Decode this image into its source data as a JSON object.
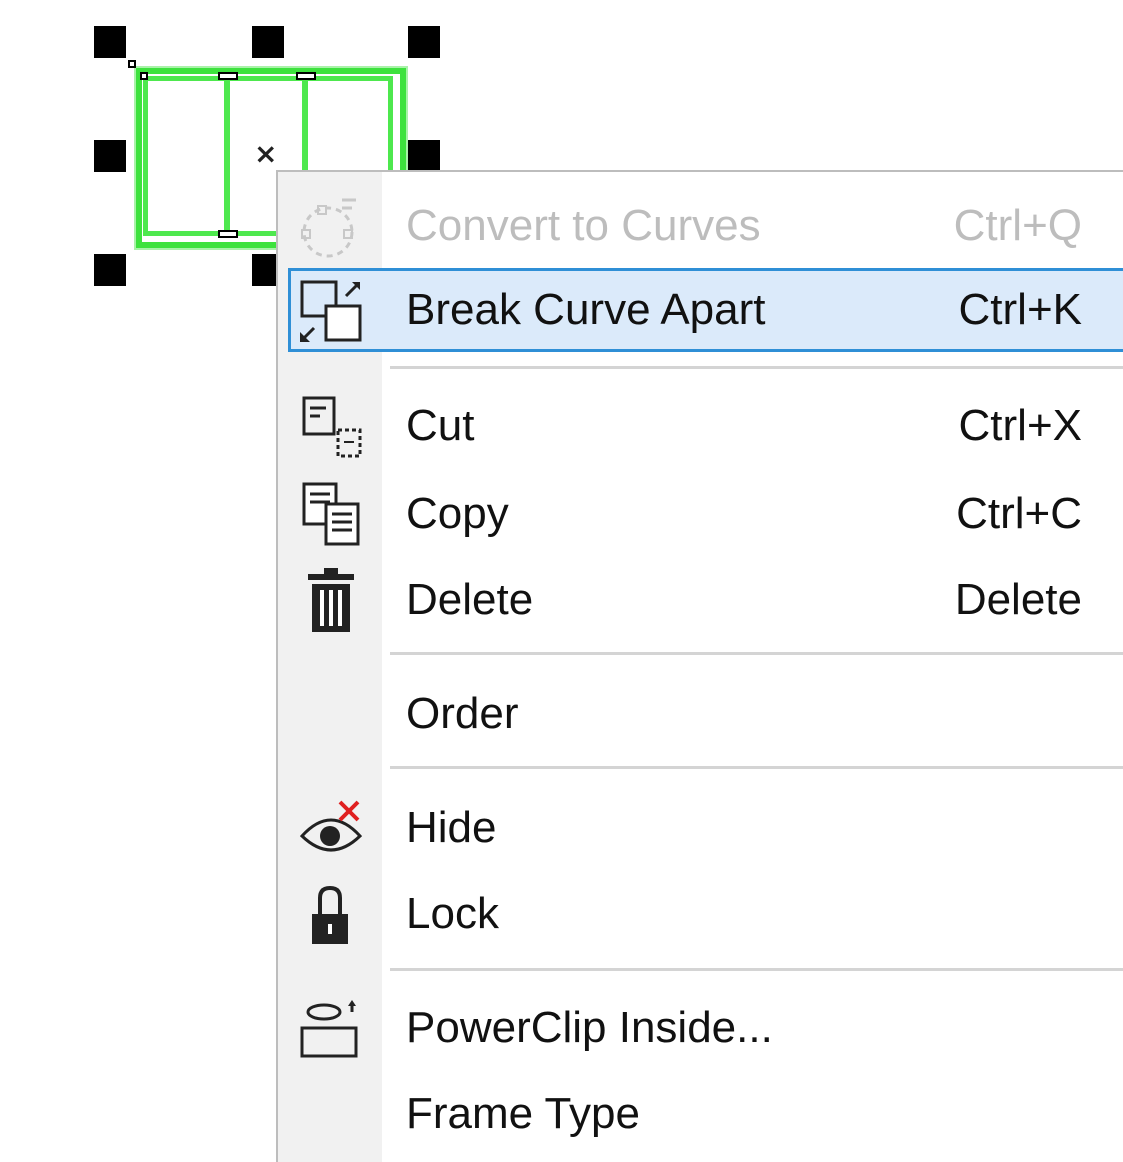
{
  "menu": {
    "items": [
      {
        "label": "Convert to Curves",
        "shortcut": "Ctrl+Q",
        "disabled": true
      },
      {
        "label": "Break Curve Apart",
        "shortcut": "Ctrl+K",
        "highlighted": true
      },
      {
        "label": "Cut",
        "shortcut": "Ctrl+X"
      },
      {
        "label": "Copy",
        "shortcut": "Ctrl+C"
      },
      {
        "label": "Delete",
        "shortcut": "Delete"
      },
      {
        "label": "Order",
        "shortcut": ""
      },
      {
        "label": "Hide",
        "shortcut": ""
      },
      {
        "label": "Lock",
        "shortcut": ""
      },
      {
        "label": "PowerClip Inside...",
        "shortcut": ""
      },
      {
        "label": "Frame Type",
        "shortcut": ""
      }
    ]
  },
  "colors": {
    "selection_outline": "#3de23d",
    "highlight_bg": "#dbeafa",
    "highlight_border": "#2f8fd6",
    "disabled_text": "#bdbdbd",
    "delete_x": "#e02020"
  },
  "icons": [
    "convert-curves-icon",
    "break-apart-icon",
    "cut-icon",
    "copy-icon",
    "trash-icon",
    "hide-icon",
    "lock-icon",
    "powerclip-icon"
  ]
}
